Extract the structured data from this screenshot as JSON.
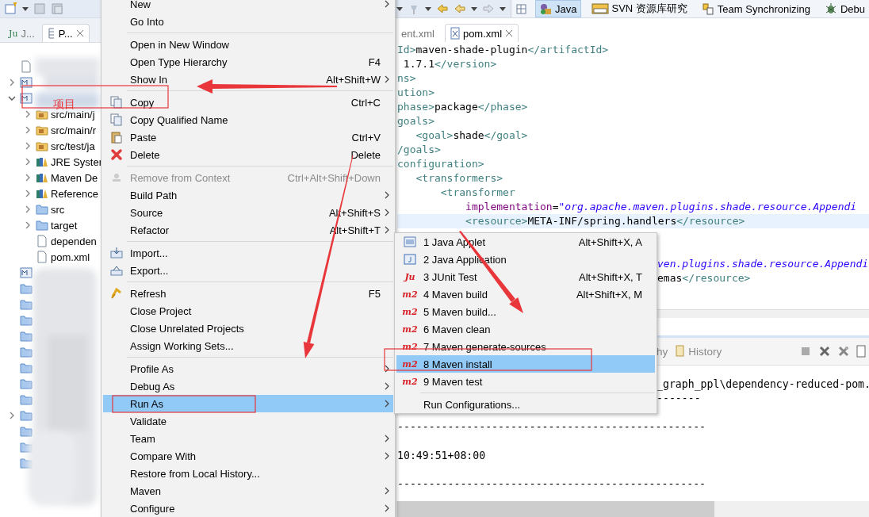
{
  "toolbar": {
    "perspectives": [
      {
        "kind": "java",
        "label": "Java",
        "selected": true
      },
      {
        "kind": "svn",
        "label": "SVN 资源库研究",
        "selected": false
      },
      {
        "kind": "team",
        "label": "Team Synchronizing",
        "selected": false
      },
      {
        "kind": "debug",
        "label": "Debu",
        "selected": false
      }
    ]
  },
  "explorer": {
    "tabs": [
      {
        "badge": "Ju",
        "label": "J...",
        "selected": false
      },
      {
        "label": "P...",
        "selected": true
      }
    ],
    "tree": [
      {
        "kind": "file"
      },
      {
        "kind": "project",
        "expanded": false
      },
      {
        "kind": "project",
        "expanded": true,
        "children": [
          {
            "kind": "package_folder",
            "label": "src/main/j",
            "expanded": false
          },
          {
            "kind": "package_folder",
            "label": "src/main/r",
            "expanded": false
          },
          {
            "kind": "package_folder",
            "label": "src/test/ja",
            "expanded": false
          },
          {
            "kind": "library",
            "label": "JRE Syster",
            "expanded": false
          },
          {
            "kind": "library",
            "label": "Maven De",
            "expanded": false
          },
          {
            "kind": "library",
            "label": "Reference",
            "expanded": false
          },
          {
            "kind": "folder",
            "label": "src",
            "expanded": false
          },
          {
            "kind": "folder",
            "label": "target",
            "expanded": false
          },
          {
            "kind": "file",
            "label": "dependen"
          },
          {
            "kind": "file",
            "label": "pom.xml"
          }
        ]
      },
      {
        "kind": "project"
      },
      {
        "kind": "folder"
      },
      {
        "kind": "folder"
      },
      {
        "kind": "folder"
      },
      {
        "kind": "folder"
      },
      {
        "kind": "folder"
      },
      {
        "kind": "folder"
      },
      {
        "kind": "folder"
      },
      {
        "kind": "folder"
      },
      {
        "kind": "folder",
        "expanded": false
      },
      {
        "kind": "folder"
      },
      {
        "kind": "folder"
      },
      {
        "kind": "folder"
      }
    ]
  },
  "editor": {
    "tabs": [
      {
        "label": "ent.xml",
        "selected": false
      },
      {
        "label": "pom.xml",
        "selected": true
      }
    ],
    "lines": [
      {
        "highlighted": false,
        "tokens": [
          {
            "kind": "tag",
            "text": "Id>"
          },
          {
            "kind": "text",
            "text": "maven-shade-plugin"
          },
          {
            "kind": "tag",
            "text": "</artifactId>"
          }
        ]
      },
      {
        "highlighted": false,
        "tokens": [
          {
            "kind": "text",
            "text": " 1.7.1"
          },
          {
            "kind": "tag",
            "text": "</version>"
          }
        ]
      },
      {
        "highlighted": false,
        "tokens": [
          {
            "kind": "tag",
            "text": "ns>"
          }
        ]
      },
      {
        "highlighted": false,
        "tokens": [
          {
            "kind": "tag",
            "text": "ution>"
          }
        ]
      },
      {
        "highlighted": false,
        "tokens": [
          {
            "kind": "tag",
            "text": "phase>"
          },
          {
            "kind": "text",
            "text": "package"
          },
          {
            "kind": "tag",
            "text": "</phase>"
          }
        ]
      },
      {
        "highlighted": false,
        "tokens": [
          {
            "kind": "tag",
            "text": "goals>"
          }
        ]
      },
      {
        "highlighted": false,
        "tokens": [
          {
            "kind": "tag",
            "text": "   <goal>"
          },
          {
            "kind": "text",
            "text": "shade"
          },
          {
            "kind": "tag",
            "text": "</goal>"
          }
        ]
      },
      {
        "highlighted": false,
        "tokens": [
          {
            "kind": "tag",
            "text": "/goals>"
          }
        ]
      },
      {
        "highlighted": false,
        "tokens": [
          {
            "kind": "tag",
            "text": "configuration>"
          }
        ]
      },
      {
        "highlighted": false,
        "tokens": [
          {
            "kind": "tag",
            "text": "   <transformers>"
          }
        ]
      },
      {
        "highlighted": false,
        "tokens": [
          {
            "kind": "tag",
            "text": "       <transformer"
          }
        ]
      },
      {
        "highlighted": false,
        "tokens": [
          {
            "kind": "attr",
            "text": "           implementation"
          },
          {
            "kind": "text",
            "text": "="
          },
          {
            "kind": "string",
            "text": "\"org.apache.maven.plugins.shade.resource.Appendi"
          }
        ]
      },
      {
        "highlighted": true,
        "tokens": [
          {
            "kind": "tag",
            "text": "           <resource>"
          },
          {
            "kind": "text",
            "text": "META-INF/spring.handlers"
          },
          {
            "kind": "tag",
            "text": "</resource>"
          }
        ]
      }
    ],
    "lines_beside_submenu": [
      {
        "highlighted": false,
        "tokens": [
          {
            "kind": "string",
            "text": "ven.plugins.shade.resource.Appendi"
          }
        ]
      },
      {
        "highlighted": false,
        "tokens": [
          {
            "kind": "text",
            "text": "emas"
          },
          {
            "kind": "tag",
            "text": "</resource>"
          }
        ]
      }
    ]
  },
  "console": {
    "tabs": [
      {
        "kind": "plain",
        "label": "hy"
      },
      {
        "kind": "history",
        "label": "History"
      }
    ],
    "lines": [
      {
        "kind": "beside_submenu",
        "text": "_graph_ppl\\dependency-reduced-pom."
      },
      {
        "kind": "beside_submenu",
        "text": "-------"
      },
      {
        "kind": "blank"
      },
      {
        "kind": "full",
        "text": "-------------------------------------------------"
      },
      {
        "kind": "blank"
      },
      {
        "kind": "full",
        "text": "10:49:51+08:00"
      },
      {
        "kind": "blank"
      },
      {
        "kind": "full",
        "text": "-------------------------------------------------"
      }
    ]
  },
  "context_menu": {
    "items": [
      {
        "kind": "plain",
        "label": "New",
        "submenu": true,
        "disabled": false,
        "selected": false
      },
      {
        "kind": "plain",
        "label": "Go Into",
        "submenu": false,
        "disabled": false,
        "selected": false
      },
      {
        "kind": "separator"
      },
      {
        "kind": "plain",
        "label": "Open in New Window",
        "submenu": false,
        "disabled": false,
        "selected": false
      },
      {
        "kind": "plain",
        "label": "Open Type Hierarchy",
        "shortcut": "F4",
        "submenu": false,
        "disabled": false,
        "selected": false
      },
      {
        "kind": "plain",
        "label": "Show In",
        "shortcut": "Alt+Shift+W",
        "submenu": true,
        "disabled": false,
        "selected": false
      },
      {
        "kind": "separator"
      },
      {
        "kind": "copy",
        "label": "Copy",
        "shortcut": "Ctrl+C",
        "submenu": false,
        "disabled": false,
        "selected": false
      },
      {
        "kind": "copy",
        "label": "Copy Qualified Name",
        "submenu": false,
        "disabled": false,
        "selected": false
      },
      {
        "kind": "paste",
        "label": "Paste",
        "shortcut": "Ctrl+V",
        "submenu": false,
        "disabled": false,
        "selected": false
      },
      {
        "kind": "delete",
        "label": "Delete",
        "shortcut": "Delete",
        "submenu": false,
        "disabled": false,
        "selected": false
      },
      {
        "kind": "separator"
      },
      {
        "kind": "remove",
        "label": "Remove from Context",
        "shortcut": "Ctrl+Alt+Shift+Down",
        "submenu": false,
        "disabled": true,
        "selected": false
      },
      {
        "kind": "plain",
        "label": "Build Path",
        "submenu": true,
        "disabled": false,
        "selected": false
      },
      {
        "kind": "plain",
        "label": "Source",
        "shortcut": "Alt+Shift+S",
        "submenu": true,
        "disabled": false,
        "selected": false
      },
      {
        "kind": "plain",
        "label": "Refactor",
        "shortcut": "Alt+Shift+T",
        "submenu": true,
        "disabled": false,
        "selected": false
      },
      {
        "kind": "separator"
      },
      {
        "kind": "import",
        "label": "Import...",
        "submenu": false,
        "disabled": false,
        "selected": false
      },
      {
        "kind": "export",
        "label": "Export...",
        "submenu": false,
        "disabled": false,
        "selected": false
      },
      {
        "kind": "separator"
      },
      {
        "kind": "refresh",
        "label": "Refresh",
        "shortcut": "F5",
        "submenu": false,
        "disabled": false,
        "selected": false
      },
      {
        "kind": "plain",
        "label": "Close Project",
        "submenu": false,
        "disabled": false,
        "selected": false
      },
      {
        "kind": "plain",
        "label": "Close Unrelated Projects",
        "submenu": false,
        "disabled": false,
        "selected": false
      },
      {
        "kind": "plain",
        "label": "Assign Working Sets...",
        "submenu": false,
        "disabled": false,
        "selected": false
      },
      {
        "kind": "separator"
      },
      {
        "kind": "plain",
        "label": "Profile As",
        "submenu": true,
        "disabled": false,
        "selected": false
      },
      {
        "kind": "plain",
        "label": "Debug As",
        "submenu": true,
        "disabled": false,
        "selected": false
      },
      {
        "kind": "plain",
        "label": "Run As",
        "submenu": true,
        "disabled": false,
        "selected": true
      },
      {
        "kind": "plain",
        "label": "Validate",
        "submenu": false,
        "disabled": false,
        "selected": false
      },
      {
        "kind": "plain",
        "label": "Team",
        "submenu": true,
        "disabled": false,
        "selected": false
      },
      {
        "kind": "plain",
        "label": "Compare With",
        "submenu": true,
        "disabled": false,
        "selected": false
      },
      {
        "kind": "plain",
        "label": "Restore from Local History...",
        "submenu": false,
        "disabled": false,
        "selected": false
      },
      {
        "kind": "plain",
        "label": "Maven",
        "submenu": true,
        "disabled": false,
        "selected": false
      },
      {
        "kind": "plain",
        "label": "Configure",
        "submenu": true,
        "disabled": false,
        "selected": false
      }
    ]
  },
  "run_as_submenu": {
    "items": [
      {
        "kind": "applet",
        "label": "1 Java Applet",
        "shortcut": "Alt+Shift+X, A",
        "selected": false
      },
      {
        "kind": "application",
        "label": "2 Java Application",
        "selected": false
      },
      {
        "kind": "badge",
        "badge": "Ju",
        "label": "3 JUnit Test",
        "shortcut": "Alt+Shift+X, T",
        "selected": false
      },
      {
        "kind": "badge",
        "badge": "m2",
        "label": "4 Maven build",
        "shortcut": "Alt+Shift+X, M",
        "selected": false
      },
      {
        "kind": "badge",
        "badge": "m2",
        "label": "5 Maven build...",
        "selected": false
      },
      {
        "kind": "badge",
        "badge": "m2",
        "label": "6 Maven clean",
        "selected": false
      },
      {
        "kind": "badge",
        "badge": "m2",
        "label": "7 Maven generate-sources",
        "selected": false
      },
      {
        "kind": "badge",
        "badge": "m2",
        "label": "8 Maven install",
        "selected": true
      },
      {
        "kind": "badge",
        "badge": "m2",
        "label": "9 Maven test",
        "selected": false
      },
      {
        "kind": "separator"
      },
      {
        "kind": "plain",
        "label": "Run Configurations...",
        "selected": false
      }
    ]
  },
  "annotation": {
    "label": "项目"
  }
}
